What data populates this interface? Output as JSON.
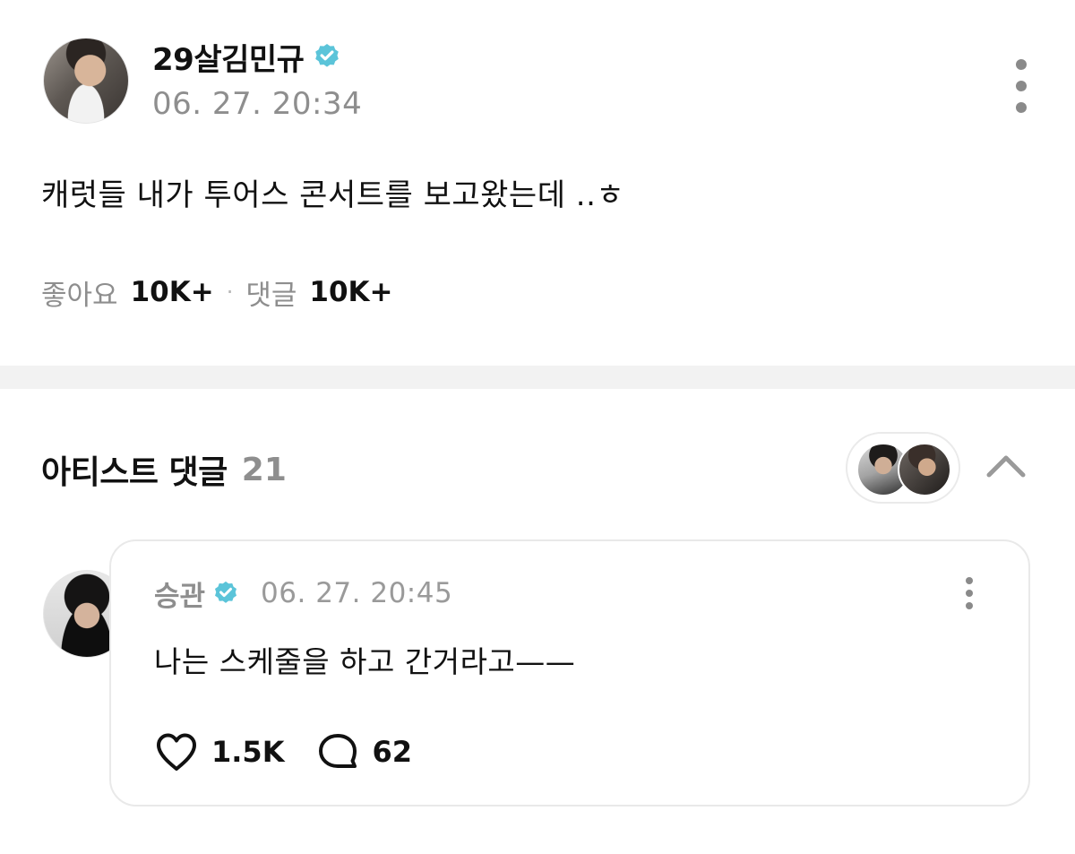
{
  "post": {
    "author_name": "29살김민규",
    "verified_icon": "verified-badge-icon",
    "timestamp": "06. 27. 20:34",
    "text": "캐럿들 내가 투어스 콘서트를 보고왔는데 ..ㅎ",
    "likes_label": "좋아요",
    "likes_count": "10K+",
    "separator": "·",
    "comments_label": "댓글",
    "comments_count": "10K+"
  },
  "artist_comments": {
    "title": "아티스트 댓글",
    "count": "21",
    "comments": [
      {
        "author_name": "승관",
        "timestamp": "06. 27. 20:45",
        "text": "나는 스케줄을 하고 간거라고——",
        "likes_count": "1.5K",
        "replies_count": "62"
      }
    ]
  },
  "colors": {
    "verified_badge": "#5bc4d9",
    "muted_text": "#8e8e8e",
    "divider": "#f2f2f2",
    "card_border": "#e9e9e9"
  }
}
